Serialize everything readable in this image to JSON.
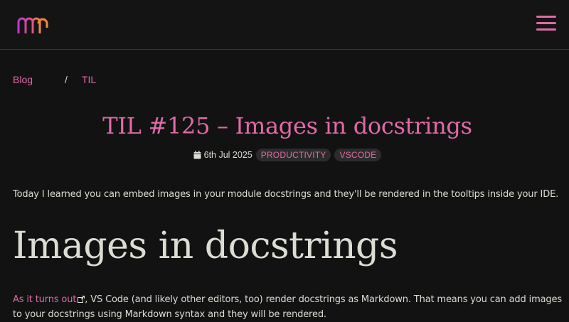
{
  "header": {
    "logo_icon": "mathspp-logo",
    "menu_icon": "hamburger-menu-icon",
    "accent_color": "#e06aa8"
  },
  "breadcrumb": {
    "items": [
      {
        "label": "Blog"
      },
      {
        "label": "TIL"
      }
    ],
    "separator": "/"
  },
  "article": {
    "title": "TIL #125 – Images in docstrings",
    "date": "6th Jul 2025",
    "date_icon": "calendar-icon",
    "tags": [
      "PRODUCTIVITY",
      "VSCODE"
    ],
    "intro": "Today I learned you can embed images in your module docstrings and they'll be rendered in the tooltips inside your IDE.",
    "heading": "Images in docstrings",
    "paragraph": {
      "link_text": "As it turns out",
      "link_icon": "external-link-icon",
      "line1_rest": ", VS Code (and likely other editors, too) render docstrings as Markdown. That means you can add images",
      "line2": "to your docstrings using Markdown syntax and they will be rendered."
    }
  }
}
